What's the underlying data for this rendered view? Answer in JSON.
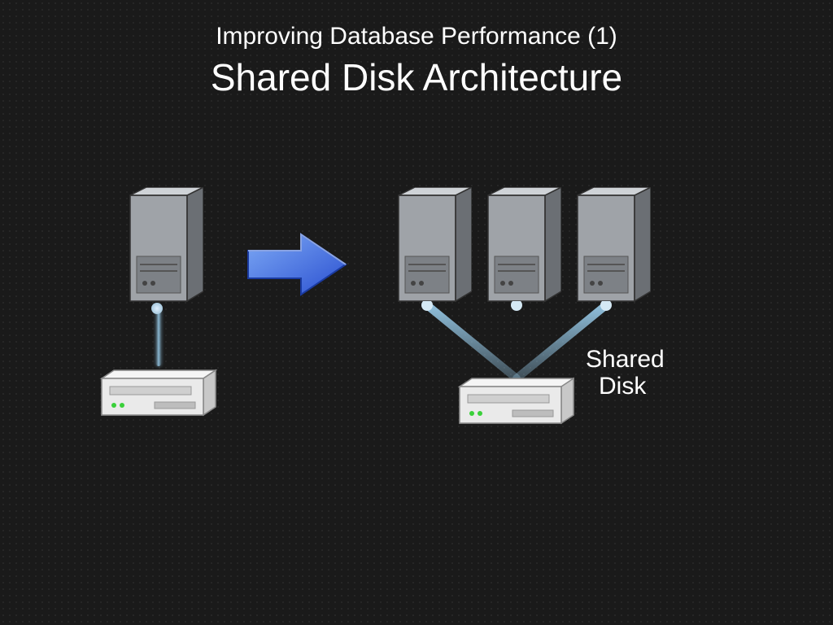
{
  "slide": {
    "subtitle": "Improving Database Performance (1)",
    "title": "Shared Disk Architecture",
    "shared_disk_label_line1": "Shared",
    "shared_disk_label_line2": "Disk"
  },
  "chart_data": {
    "type": "diagram",
    "title": "Shared Disk Architecture",
    "left_group": {
      "servers": 1,
      "disks": 1,
      "connections": [
        {
          "from": "server1",
          "to": "disk1"
        }
      ]
    },
    "right_group": {
      "servers": 3,
      "disks": 1,
      "disk_label": "Shared Disk",
      "connections": [
        {
          "from": "server1",
          "to": "disk1"
        },
        {
          "from": "server2",
          "to": "disk1"
        },
        {
          "from": "server3",
          "to": "disk1"
        }
      ]
    },
    "transition": "arrow-left-to-right"
  }
}
